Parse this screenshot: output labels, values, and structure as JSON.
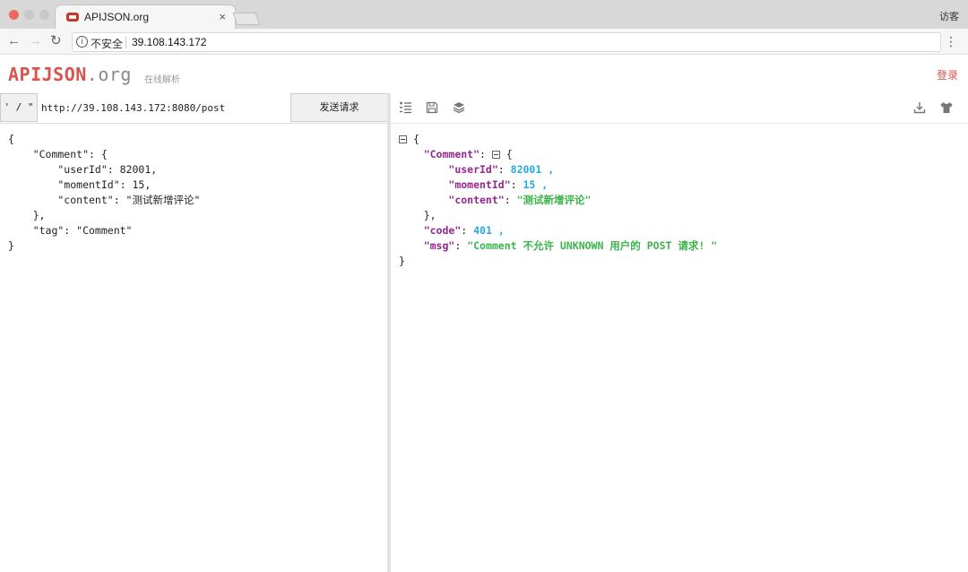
{
  "browser": {
    "tab_title": "APIJSON.org",
    "tab_close": "×",
    "guest_label": "访客",
    "insecure_label": "不安全",
    "url": "39.108.143.172"
  },
  "app": {
    "logo_main": "APIJSON",
    "logo_suffix": ".org",
    "subtitle": "在线解析",
    "login_label": "登录",
    "brand_color": "#d9534f"
  },
  "request": {
    "quote_button": "' / \"",
    "url_value": "http://39.108.143.172:8080/post",
    "send_button": "发送请求",
    "body_lines": [
      "{",
      "    \"Comment\": {",
      "        \"userId\": 82001,",
      "        \"momentId\": 15,",
      "        \"content\": \"测试新增评论\"",
      "    },",
      "    \"tag\": \"Comment\"",
      "}"
    ]
  },
  "response": {
    "toolbar_icons": [
      "list-format-icon",
      "save-icon",
      "layers-icon",
      "download-icon",
      "shirt-icon"
    ],
    "open_brace": "{",
    "comment_key": "\"Comment\"",
    "userId_key": "\"userId\"",
    "userId_value": "82001",
    "momentId_key": "\"momentId\"",
    "momentId_value": "15",
    "content_key": "\"content\"",
    "content_value": "\"测试新增评论\"",
    "close_obj": "},",
    "code_key": "\"code\"",
    "code_value": "401",
    "msg_key": "\"msg\"",
    "msg_value": "\"Comment 不允许 UNKNOWN 用户的 POST 请求! \"",
    "close_brace": "}",
    "colors": {
      "key": "#92278f",
      "number": "#25aae2",
      "string": "#3ab54a"
    }
  }
}
